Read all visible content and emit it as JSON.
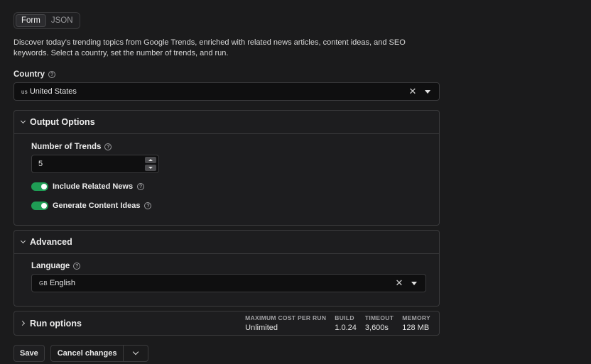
{
  "tabs": [
    {
      "label": "Form",
      "active": true
    },
    {
      "label": "JSON",
      "active": false
    }
  ],
  "description": "Discover today's trending topics from Google Trends, enriched with related news articles, content ideas, and SEO keywords. Select a country, set the number of trends, and run.",
  "country": {
    "label": "Country",
    "flag_code": "us",
    "value": "United States"
  },
  "output_options": {
    "title": "Output Options",
    "number_of_trends_label": "Number of Trends",
    "number_of_trends_value": "5",
    "include_related_news_label": "Include Related News",
    "include_related_news_on": true,
    "generate_content_ideas_label": "Generate Content Ideas",
    "generate_content_ideas_on": true
  },
  "advanced": {
    "title": "Advanced",
    "language_label": "Language",
    "language_flag_code": "GB",
    "language_value": "English"
  },
  "run_options": {
    "title": "Run options",
    "stats": [
      {
        "key": "MAXIMUM COST PER RUN",
        "value": "Unlimited"
      },
      {
        "key": "BUILD",
        "value": "1.0.24"
      },
      {
        "key": "TIMEOUT",
        "value": "3,600s"
      },
      {
        "key": "MEMORY",
        "value": "128 MB"
      }
    ]
  },
  "actions": {
    "save_label": "Save",
    "cancel_label": "Cancel changes"
  },
  "colors": {
    "background": "#1b1b1c",
    "toggle_on": "#1f9d55",
    "border": "#3a3a3c"
  },
  "icons": {
    "help": "help-circle-icon",
    "clear": "close-icon",
    "dropdown": "chevron-down-icon",
    "expand": "chevron-right-icon"
  }
}
